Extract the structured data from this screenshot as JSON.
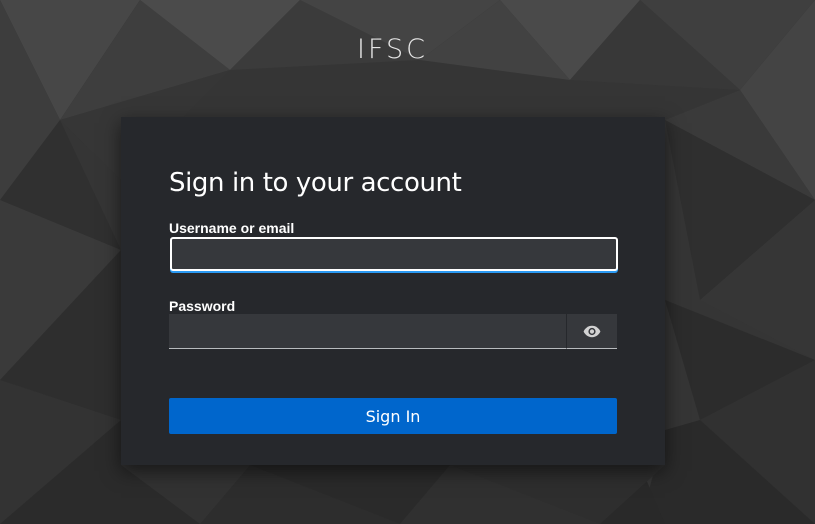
{
  "realm": {
    "title": "IFSC"
  },
  "login": {
    "heading": "Sign in to your account",
    "username": {
      "label": "Username or email",
      "value": "",
      "placeholder": ""
    },
    "password": {
      "label": "Password",
      "value": "",
      "placeholder": "",
      "toggle_icon": "eye-icon"
    },
    "submit_label": "Sign In"
  },
  "colors": {
    "card_background": "#26282c",
    "input_background": "#36383c",
    "primary": "#0066cc",
    "focus_underline": "#2b9af3"
  }
}
